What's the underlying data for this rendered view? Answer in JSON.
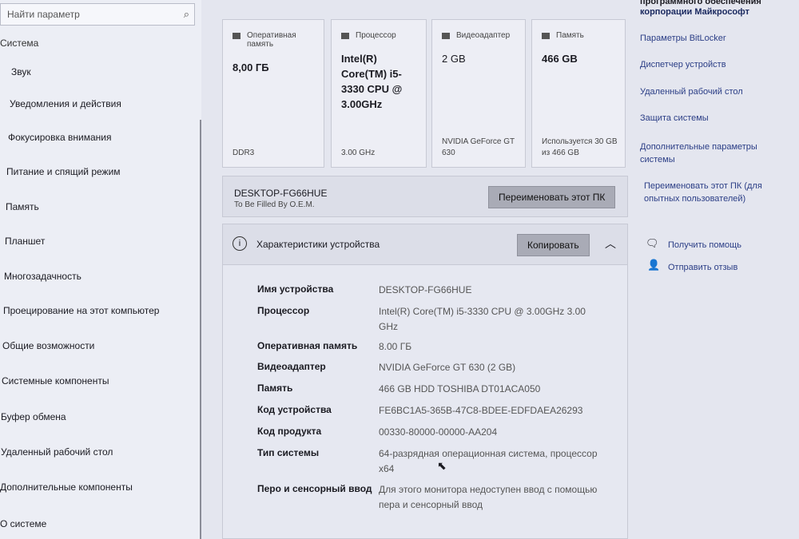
{
  "sidebar": {
    "search_placeholder": "Найти параметр",
    "section": "Система",
    "items": [
      "Звук",
      "Уведомления и действия",
      "Фокусировка внимания",
      "Питание и спящий режим",
      "Память",
      "Планшет",
      "Многозадачность",
      "Проецирование на этот компьютер",
      "Общие возможности",
      "Системные компоненты",
      "Буфер обмена",
      "Удаленный рабочий стол",
      "Дополнительные компоненты",
      "О системе"
    ]
  },
  "cards": [
    {
      "label": "Оперативная память",
      "value": "8,00 ГБ",
      "sub": "DDR3",
      "icon": "ram-icon"
    },
    {
      "label": "Процессор",
      "value": "Intel(R) Core(TM) i5-3330 CPU @ 3.00GHz",
      "sub": "3.00 GHz",
      "icon": "cpu-icon"
    },
    {
      "label": "Видеоадаптер",
      "value": "2 GB",
      "sub": "NVIDIA GeForce GT 630",
      "icon": "gpu-icon"
    },
    {
      "label": "Память",
      "value": "466 GB",
      "sub": "Используется 30 GB из 466 GB",
      "icon": "storage-icon"
    }
  ],
  "device": {
    "name": "DESKTOP-FG66HUE",
    "oem": "To Be Filled By O.E.M.",
    "rename_label": "Переименовать этот ПК"
  },
  "specs": {
    "title": "Характеристики устройства",
    "copy_label": "Копировать",
    "rows": [
      {
        "k": "Имя устройства",
        "v": "DESKTOP-FG66HUE"
      },
      {
        "k": "Процессор",
        "v": "Intel(R) Core(TM) i5-3330 CPU @ 3.00GHz   3.00 GHz"
      },
      {
        "k": "Оперативная память",
        "v": "8.00 ГБ"
      },
      {
        "k": "Видеоадаптер",
        "v": "NVIDIA GeForce GT 630 (2 GB)"
      },
      {
        "k": "Память",
        "v": "466 GB HDD TOSHIBA DT01ACA050"
      },
      {
        "k": "Код устройства",
        "v": "FE6BC1A5-365B-47C8-BDEE-EDFDAEA26293"
      },
      {
        "k": "Код продукта",
        "v": "00330-80000-00000-AA204"
      },
      {
        "k": "Тип системы",
        "v": "64-разрядная операционная система, процессор x64"
      },
      {
        "k": "Перо и сенсорный ввод",
        "v": "Для этого монитора недоступен ввод с помощью пера и сенсорный ввод"
      }
    ]
  },
  "related": {
    "top_partial": "программного обеспечения",
    "top": "корпорации Майкрософт",
    "links": [
      "Параметры BitLocker",
      "Диспетчер устройств",
      "Удаленный рабочий стол",
      "Защита системы",
      "Дополнительные параметры системы",
      "Переименовать этот ПК (для опытных пользователей)"
    ],
    "help": "Получить помощь",
    "feedback": "Отправить отзыв"
  }
}
